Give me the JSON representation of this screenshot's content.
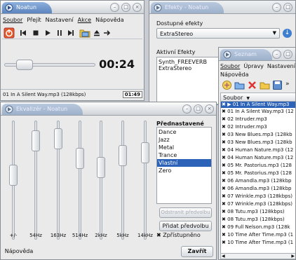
{
  "player": {
    "title": "Noatun",
    "menu": [
      "Soubor",
      "Přejít",
      "Nastavení",
      "Akce",
      "Nápověda"
    ],
    "time": "00:24",
    "track": "01 In A Silent Way.mp3 (128kbps)",
    "duration": "01:49",
    "position_fraction": 0.22
  },
  "effects": {
    "title": "Efekty - Noatun",
    "available_label": "Dostupné efekty",
    "selected_effect": "ExtraStereo",
    "active_label": "Aktivní Efekty",
    "active_items": [
      "Synth_FREEVERB",
      "ExtraStereo"
    ]
  },
  "playlist": {
    "title": "Seznam",
    "menu": [
      "Soubor",
      "Úpravy",
      "Nastavení",
      "Nápověda"
    ],
    "column": "Soubor",
    "items": [
      "01 In A Silent Way.mp3",
      "01 In A Silent Way.mp3 (12",
      "02 Intruder.mp3",
      "02 Intruder.mp3",
      "03 New Blues.mp3 (128kb",
      "03 New Blues.mp3 (128kb",
      "04 Human Nature.mp3 (12",
      "04 Human Nature.mp3 (12",
      "05 Mr. Pastorius.mp3 (128",
      "05 Mr. Pastorius.mp3 (128",
      "06 Amandla.mp3 (128kbp",
      "06 Amandla.mp3 (128kbp",
      "07 Wrinkle.mp3 (128kbps)",
      "07 Wrinkle.mp3 (128kbps)",
      "08 Tutu.mp3 (128kbps)",
      "08 Tutu.mp3 (128kbps)",
      "09 Full Nelson.mp3 (128k",
      "10 Time After Time.mp3 (1",
      "10 Time After Time.mp3 (1"
    ]
  },
  "equalizer": {
    "title": "Ekvalizér - Noatun",
    "band_labels": [
      "+/-",
      "54Hz",
      "163Hz",
      "514Hz",
      "2kHz",
      "5kHz",
      "14kHz"
    ],
    "levels": [
      0.55,
      0.9,
      0.92,
      0.72,
      0.63,
      0.75,
      0.78
    ],
    "presets_label": "Přednastavené",
    "presets": [
      "Dance",
      "Jazz",
      "Metal",
      "Trance",
      "Vlastní",
      "Zero"
    ],
    "selected_preset": "Vlastní",
    "remove_button": "Odstranit předvolbu",
    "add_button": "Přidat předvolbu",
    "enabled_label": "Zpřístupněno",
    "help_button": "Nápověda",
    "close_button": "Zavřít"
  },
  "colors": {
    "accent": "#2c63b8",
    "title_tab": "#6f94c9"
  }
}
